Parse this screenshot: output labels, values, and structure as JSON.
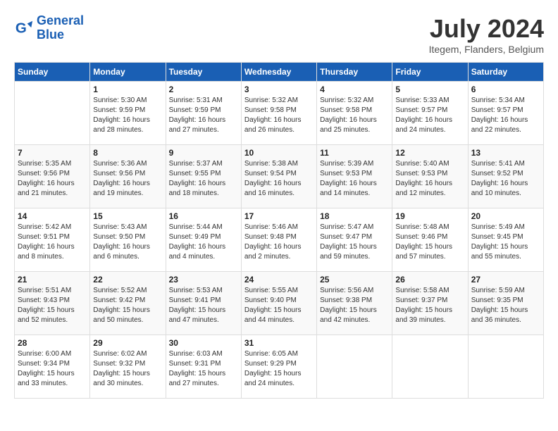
{
  "header": {
    "logo_line1": "General",
    "logo_line2": "Blue",
    "month_year": "July 2024",
    "location": "Itegem, Flanders, Belgium"
  },
  "weekdays": [
    "Sunday",
    "Monday",
    "Tuesday",
    "Wednesday",
    "Thursday",
    "Friday",
    "Saturday"
  ],
  "weeks": [
    [
      {
        "day": "",
        "info": ""
      },
      {
        "day": "1",
        "info": "Sunrise: 5:30 AM\nSunset: 9:59 PM\nDaylight: 16 hours\nand 28 minutes."
      },
      {
        "day": "2",
        "info": "Sunrise: 5:31 AM\nSunset: 9:59 PM\nDaylight: 16 hours\nand 27 minutes."
      },
      {
        "day": "3",
        "info": "Sunrise: 5:32 AM\nSunset: 9:58 PM\nDaylight: 16 hours\nand 26 minutes."
      },
      {
        "day": "4",
        "info": "Sunrise: 5:32 AM\nSunset: 9:58 PM\nDaylight: 16 hours\nand 25 minutes."
      },
      {
        "day": "5",
        "info": "Sunrise: 5:33 AM\nSunset: 9:57 PM\nDaylight: 16 hours\nand 24 minutes."
      },
      {
        "day": "6",
        "info": "Sunrise: 5:34 AM\nSunset: 9:57 PM\nDaylight: 16 hours\nand 22 minutes."
      }
    ],
    [
      {
        "day": "7",
        "info": "Sunrise: 5:35 AM\nSunset: 9:56 PM\nDaylight: 16 hours\nand 21 minutes."
      },
      {
        "day": "8",
        "info": "Sunrise: 5:36 AM\nSunset: 9:56 PM\nDaylight: 16 hours\nand 19 minutes."
      },
      {
        "day": "9",
        "info": "Sunrise: 5:37 AM\nSunset: 9:55 PM\nDaylight: 16 hours\nand 18 minutes."
      },
      {
        "day": "10",
        "info": "Sunrise: 5:38 AM\nSunset: 9:54 PM\nDaylight: 16 hours\nand 16 minutes."
      },
      {
        "day": "11",
        "info": "Sunrise: 5:39 AM\nSunset: 9:53 PM\nDaylight: 16 hours\nand 14 minutes."
      },
      {
        "day": "12",
        "info": "Sunrise: 5:40 AM\nSunset: 9:53 PM\nDaylight: 16 hours\nand 12 minutes."
      },
      {
        "day": "13",
        "info": "Sunrise: 5:41 AM\nSunset: 9:52 PM\nDaylight: 16 hours\nand 10 minutes."
      }
    ],
    [
      {
        "day": "14",
        "info": "Sunrise: 5:42 AM\nSunset: 9:51 PM\nDaylight: 16 hours\nand 8 minutes."
      },
      {
        "day": "15",
        "info": "Sunrise: 5:43 AM\nSunset: 9:50 PM\nDaylight: 16 hours\nand 6 minutes."
      },
      {
        "day": "16",
        "info": "Sunrise: 5:44 AM\nSunset: 9:49 PM\nDaylight: 16 hours\nand 4 minutes."
      },
      {
        "day": "17",
        "info": "Sunrise: 5:46 AM\nSunset: 9:48 PM\nDaylight: 16 hours\nand 2 minutes."
      },
      {
        "day": "18",
        "info": "Sunrise: 5:47 AM\nSunset: 9:47 PM\nDaylight: 15 hours\nand 59 minutes."
      },
      {
        "day": "19",
        "info": "Sunrise: 5:48 AM\nSunset: 9:46 PM\nDaylight: 15 hours\nand 57 minutes."
      },
      {
        "day": "20",
        "info": "Sunrise: 5:49 AM\nSunset: 9:45 PM\nDaylight: 15 hours\nand 55 minutes."
      }
    ],
    [
      {
        "day": "21",
        "info": "Sunrise: 5:51 AM\nSunset: 9:43 PM\nDaylight: 15 hours\nand 52 minutes."
      },
      {
        "day": "22",
        "info": "Sunrise: 5:52 AM\nSunset: 9:42 PM\nDaylight: 15 hours\nand 50 minutes."
      },
      {
        "day": "23",
        "info": "Sunrise: 5:53 AM\nSunset: 9:41 PM\nDaylight: 15 hours\nand 47 minutes."
      },
      {
        "day": "24",
        "info": "Sunrise: 5:55 AM\nSunset: 9:40 PM\nDaylight: 15 hours\nand 44 minutes."
      },
      {
        "day": "25",
        "info": "Sunrise: 5:56 AM\nSunset: 9:38 PM\nDaylight: 15 hours\nand 42 minutes."
      },
      {
        "day": "26",
        "info": "Sunrise: 5:58 AM\nSunset: 9:37 PM\nDaylight: 15 hours\nand 39 minutes."
      },
      {
        "day": "27",
        "info": "Sunrise: 5:59 AM\nSunset: 9:35 PM\nDaylight: 15 hours\nand 36 minutes."
      }
    ],
    [
      {
        "day": "28",
        "info": "Sunrise: 6:00 AM\nSunset: 9:34 PM\nDaylight: 15 hours\nand 33 minutes."
      },
      {
        "day": "29",
        "info": "Sunrise: 6:02 AM\nSunset: 9:32 PM\nDaylight: 15 hours\nand 30 minutes."
      },
      {
        "day": "30",
        "info": "Sunrise: 6:03 AM\nSunset: 9:31 PM\nDaylight: 15 hours\nand 27 minutes."
      },
      {
        "day": "31",
        "info": "Sunrise: 6:05 AM\nSunset: 9:29 PM\nDaylight: 15 hours\nand 24 minutes."
      },
      {
        "day": "",
        "info": ""
      },
      {
        "day": "",
        "info": ""
      },
      {
        "day": "",
        "info": ""
      }
    ]
  ]
}
